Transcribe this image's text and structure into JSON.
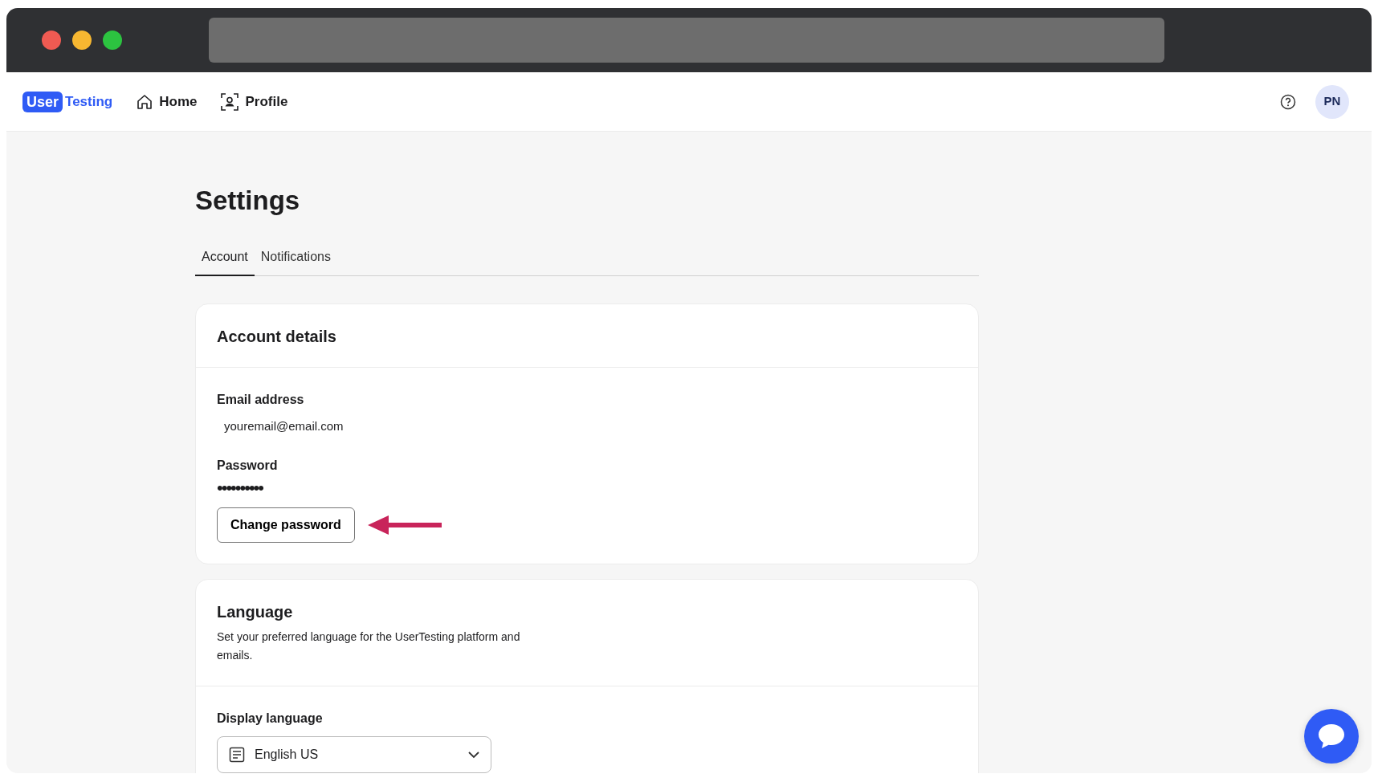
{
  "logo": {
    "user": "User",
    "testing": "Testing"
  },
  "nav": [
    {
      "label": "Home",
      "kind": "home"
    },
    {
      "label": "Profile",
      "kind": "profile"
    }
  ],
  "avatar": "PN",
  "title": "Settings",
  "tabs": [
    {
      "label": "Account",
      "selected": true
    },
    {
      "label": "Notifications",
      "selected": false
    }
  ],
  "account_card": {
    "title": "Account details",
    "email_label": "Email address",
    "email": "youremail@email.com",
    "password_label": "Password",
    "password": "••••••••••",
    "button": "Change password"
  },
  "language_card": {
    "title": "Language",
    "description": "Set your preferred language for the UserTesting platform and emails.",
    "field_label": "Display language",
    "value": "English US"
  }
}
